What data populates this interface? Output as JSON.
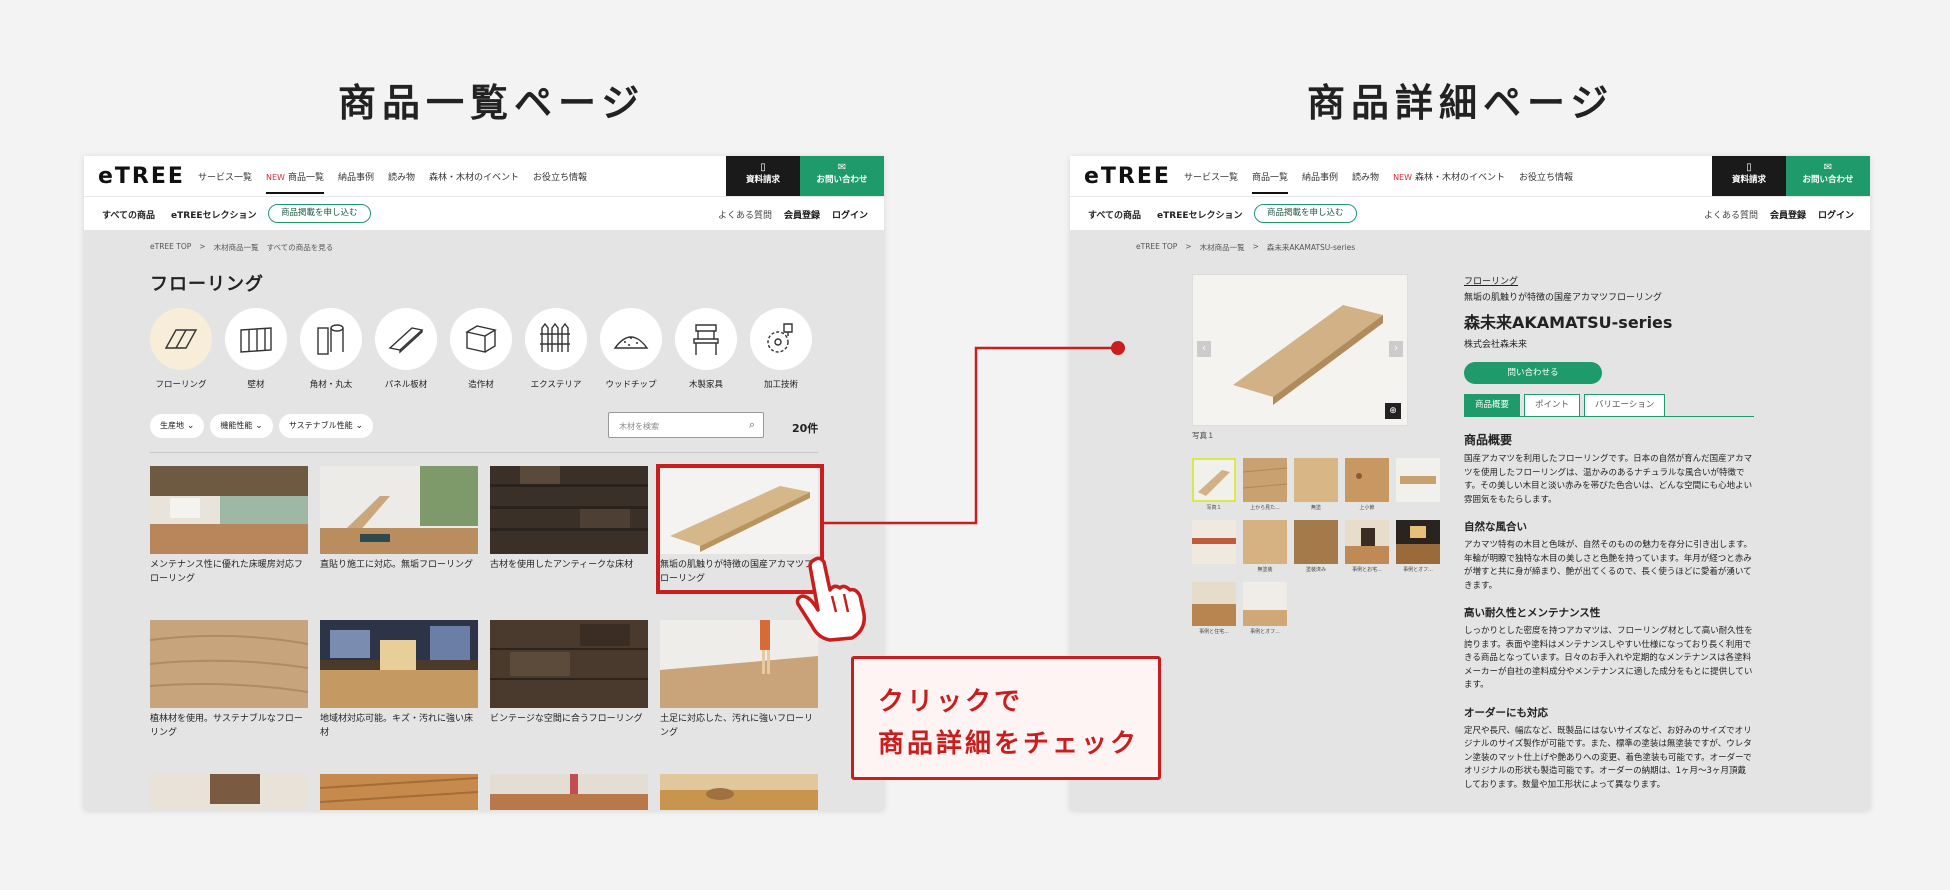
{
  "headings": {
    "list_page": "商品一覧ページ",
    "detail_page": "商品詳細ページ"
  },
  "site": {
    "logo": "eTREE",
    "nav_new_label": "NEW",
    "nav": [
      "サービス一覧",
      "商品一覧",
      "納品事例",
      "読み物",
      "森林・木材のイベント",
      "お役立ち情報"
    ],
    "doc_button": "資料請求",
    "contact_button": "お問い合わせ",
    "subnav": [
      "すべての商品",
      "eTREEセレクション"
    ],
    "listing_pill": "商品掲載を申し込む",
    "sub_right": {
      "faq": "よくある質問",
      "register": "会員登録",
      "login": "ログイン"
    }
  },
  "list_page": {
    "breadcrumb": [
      "eTREE TOP",
      ">",
      "木材商品一覧",
      "すべての商品を見る"
    ],
    "title": "フローリング",
    "categories": [
      {
        "label": "フローリング",
        "icon": "flooring-icon"
      },
      {
        "label": "壁材",
        "icon": "wall-panel-icon"
      },
      {
        "label": "角材・丸太",
        "icon": "lumber-icon"
      },
      {
        "label": "パネル板材",
        "icon": "panel-board-icon"
      },
      {
        "label": "造作材",
        "icon": "molding-icon"
      },
      {
        "label": "エクステリア",
        "icon": "fence-icon"
      },
      {
        "label": "ウッドチップ",
        "icon": "wood-chip-icon"
      },
      {
        "label": "木製家具",
        "icon": "chair-icon"
      },
      {
        "label": "加工技術",
        "icon": "saw-blade-icon"
      }
    ],
    "filters": [
      "生産地",
      "機能性能",
      "サステナブル性能"
    ],
    "search_placeholder": "木材を検索",
    "count": "20件",
    "items": [
      "メンテナンス性に優れた床暖房対応フローリング",
      "直貼り施工に対応。無垢フローリング",
      "古材を使用したアンティークな床材",
      "無垢の肌触りが特徴の国産アカマツフローリング",
      "植林材を使用。サステナブルなフローリング",
      "地域材対応可能。キズ・汚れに強い床材",
      "ビンテージな空間に合うフローリング",
      "土足に対応した、汚れに強いフローリング"
    ]
  },
  "detail_page": {
    "nav_new_label": "NEW",
    "breadcrumb": [
      "eTREE TOP",
      ">",
      "木材商品一覧",
      ">",
      "森未来AKAMATSU-series"
    ],
    "photo_label": "写真１",
    "thumb_labels": [
      "写真１",
      "上から見た...",
      "無塗",
      "上小節",
      "",
      "",
      "無塗装",
      "塗装済み",
      "事例とお宅...",
      "事例とオフ...",
      "事例と住宅...",
      "事例とオフ..."
    ],
    "category_link": "フローリング",
    "subtitle": "無垢の肌触りが特徴の国産アカマツフローリング",
    "product_name": "森未来AKAMATSU-series",
    "maker": "株式会社森未来",
    "inquiry_button": "問い合わせる",
    "tabs": [
      "商品概要",
      "ポイント",
      "バリエーション"
    ],
    "sections": [
      {
        "heading": "商品概要",
        "body": "国産アカマツを利用したフローリングです。日本の自然が育んだ国産アカマツを使用したフローリングは、温かみのあるナチュラルな風合いが特徴です。その美しい木目と淡い赤みを帯びた色合いは、どんな空間にも心地よい雰囲気をもたらします。"
      },
      {
        "heading": "自然な風合い",
        "body": "アカマツ特有の木目と色味が、自然そのものの魅力を存分に引き出します。年輪が明瞭で独特な木目の美しさと色艶を持っています。年月が経つと赤みが増すと共に身が締まり、艶が出てくるので、長く使うほどに愛着が湧いてきます。"
      },
      {
        "heading": "高い耐久性とメンテナンス性",
        "body": "しっかりとした密度を持つアカマツは、フローリング材として高い耐久性を誇ります。表面や塗料はメンテナンスしやすい仕様になっており長く利用できる商品となっています。日々のお手入れや定期的なメンテナンスは各塗料メーカーが自社の塗料成分やメンテナンスに適した成分をもとに提供しています。"
      },
      {
        "heading": "オーダーにも対応",
        "body": "定尺や長尺、幅広など、既製品にはないサイズなど、お好みのサイズでオリジナルのサイズ製作が可能です。また、標準の塗装は無塗装ですが、ウレタン塗装のマット仕上げや艶ありへの変更、着色塗装も可能です。オーダーでオリジナルの形状も製造可能です。オーダーの納期は、1ヶ月〜3ヶ月頂戴しております。数量や加工形状によって異なります。"
      }
    ]
  },
  "callout": {
    "line1": "クリックで",
    "line2": "商品詳細をチェック"
  },
  "colors": {
    "brand_green": "#1f9a6a",
    "highlight_red": "#c81e1e",
    "new_label": "#d2313a"
  }
}
